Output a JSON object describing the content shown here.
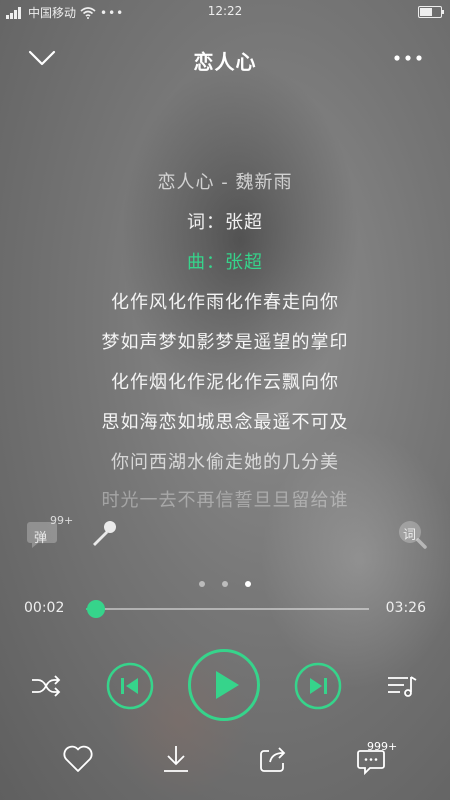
{
  "status_bar": {
    "carrier": "中国移动",
    "time": "12:22",
    "battery_level": 0.6
  },
  "header": {
    "title": "恋人心"
  },
  "lyrics": {
    "lines": [
      {
        "text": "恋人心 - 魏新雨",
        "state": "dim"
      },
      {
        "text": "词：张超",
        "state": "normal"
      },
      {
        "text": "曲：张超",
        "state": "active"
      },
      {
        "text": "化作风化作雨化作春走向你",
        "state": "normal"
      },
      {
        "text": "梦如声梦如影梦是遥望的掌印",
        "state": "normal"
      },
      {
        "text": "化作烟化作泥化作云飘向你",
        "state": "normal"
      },
      {
        "text": "思如海恋如城思念最遥不可及",
        "state": "normal"
      },
      {
        "text": "你问西湖水偷走她的几分美",
        "state": "dim"
      },
      {
        "text": "时光一去不再信誓旦旦留给谁",
        "state": "faded"
      }
    ]
  },
  "danmu": {
    "label": "弹",
    "count": "99+"
  },
  "lyric_toggle": {
    "label": "词"
  },
  "page_indicator": {
    "total": 3,
    "active": 3
  },
  "progress": {
    "current": "00:02",
    "total": "03:26",
    "fraction": 0.01
  },
  "comments": {
    "count": "999+"
  },
  "colors": {
    "accent": "#36d48b"
  }
}
